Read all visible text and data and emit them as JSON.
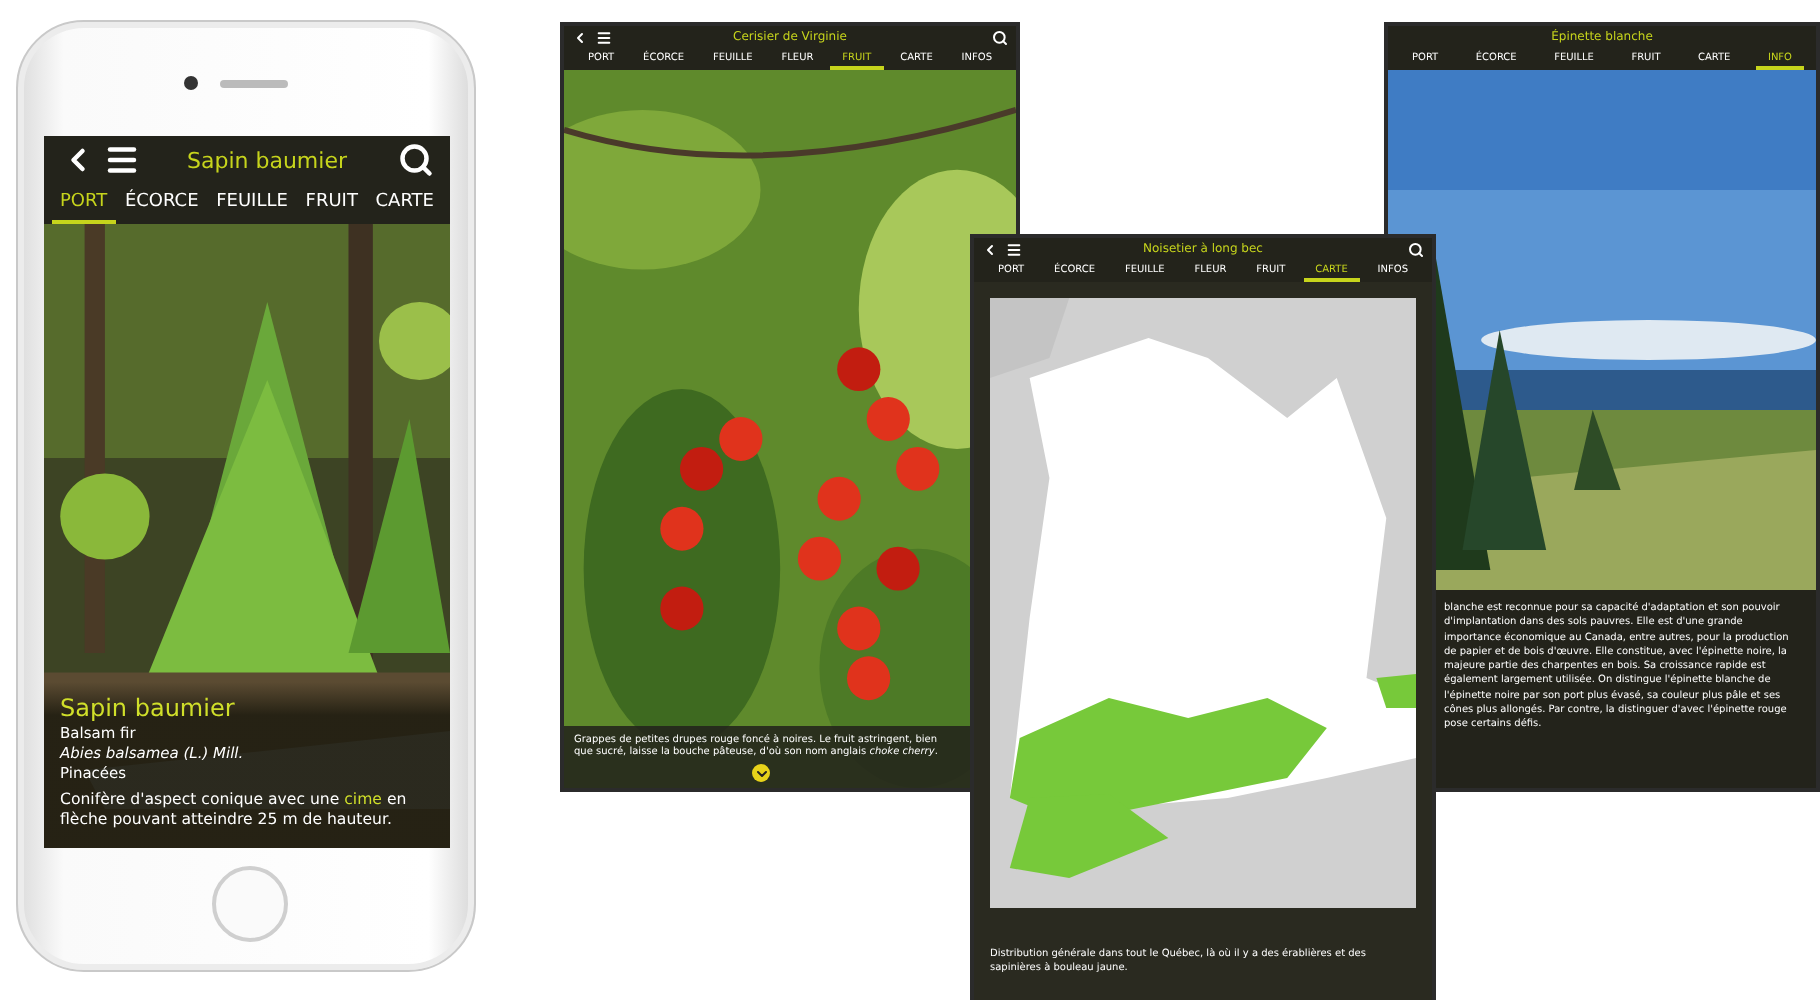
{
  "devices": [
    {
      "kind": "phone",
      "title": "Sapin baumier",
      "tabs": [
        {
          "label": "PORT",
          "selected": true
        },
        {
          "label": "ÉCORCE",
          "selected": false
        },
        {
          "label": "FEUILLE",
          "selected": false
        },
        {
          "label": "FRUIT",
          "selected": false
        },
        {
          "label": "CARTE",
          "selected": false
        }
      ],
      "name": "Sapin baumier",
      "lines": [
        "Balsam fir",
        "*Abies balsamea (L.) Mill.*",
        "Pinacées"
      ],
      "description": "Conifère d'aspect conique avec une **cime** en flèche pouvant atteindre 25 m de hauteur."
    },
    {
      "title": "Cerisier de Virginie",
      "tabs": [
        {
          "label": "PORT",
          "selected": false
        },
        {
          "label": "ÉCORCE",
          "selected": false
        },
        {
          "label": "FEUILLE",
          "selected": false
        },
        {
          "label": "FLEUR",
          "selected": false
        },
        {
          "label": "FRUIT",
          "selected": true
        },
        {
          "label": "CARTE",
          "selected": false
        },
        {
          "label": "INFOS",
          "selected": false
        }
      ],
      "description": "Grappes de petites drupes rouge foncé à noires. Le fruit astringent, bien que sucré, laisse la bouche pâteuse, d'où son nom anglais *choke cherry*."
    },
    {
      "kind": "info",
      "title": "Épinette blanche",
      "tabs": [
        {
          "label": "PORT",
          "selected": false
        },
        {
          "label": "ÉCORCE",
          "selected": false
        },
        {
          "label": "FEUILLE",
          "selected": false
        },
        {
          "label": "FRUIT",
          "selected": false
        },
        {
          "label": "CARTE",
          "selected": false
        },
        {
          "label": "INFO",
          "selected": true
        }
      ],
      "description": "blanche est reconnue pour sa capacité d'adaptation et son pouvoir d'implantation dans des sols pauvres. Elle est d'une grande importance économique au Canada, entre autres, pour la production de papier et de bois d'œuvre. Elle constitue, avec l'épinette noire, la majeure partie des charpentes en bois. Sa croissance rapide est également largement utilisée. On distingue l'épinette blanche de l'épinette noire par son port plus évasé, sa couleur plus pâle et ses cônes plus allongés. Par contre, la distinguer d'avec l'épinette rouge pose certains défis."
    },
    {
      "kind": "map",
      "title": "Noisetier à long bec",
      "tabs": [
        {
          "label": "PORT",
          "selected": false
        },
        {
          "label": "ÉCORCE",
          "selected": false
        },
        {
          "label": "FEUILLE",
          "selected": false
        },
        {
          "label": "FLEUR",
          "selected": false
        },
        {
          "label": "FRUIT",
          "selected": false
        },
        {
          "label": "CARTE",
          "selected": true
        },
        {
          "label": "INFOS",
          "selected": false
        }
      ],
      "description": "Distribution générale dans tout le Québec, là où il y a des érablières et des sapinières à bouleau jaune."
    }
  ]
}
